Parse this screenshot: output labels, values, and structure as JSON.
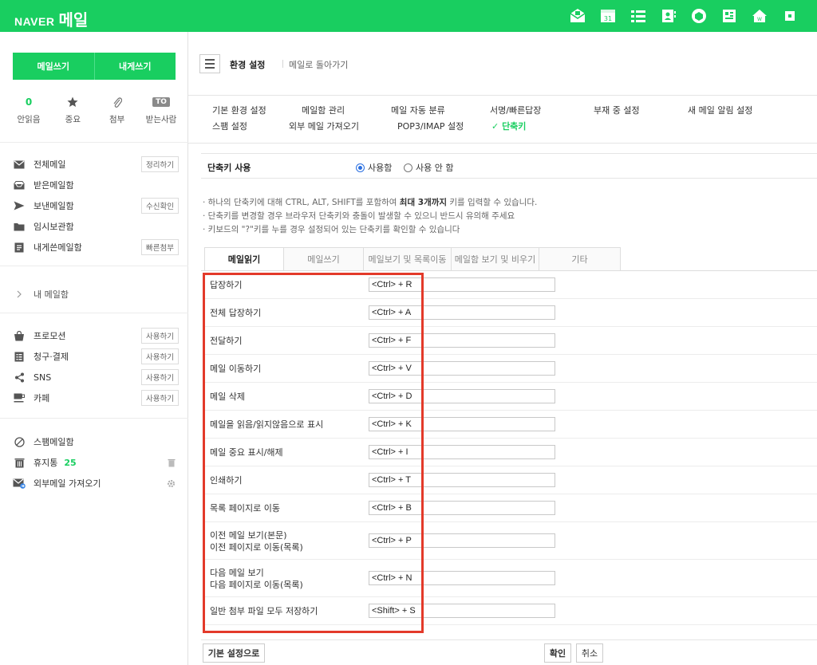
{
  "app": {
    "logo_brand": "NAVER",
    "logo_service": "메일",
    "colors": {
      "brand_green": "#19ce60",
      "highlight_red": "#e33a2a",
      "radio_blue": "#2a6fe0"
    },
    "top_icons": [
      "mail-app-icon",
      "calendar-icon",
      "list-icon",
      "contacts-icon",
      "cube-icon",
      "memo-icon",
      "home-icon",
      "square-icon"
    ],
    "calendar_number": "31"
  },
  "sidebar": {
    "compose_label": "메일쓰기",
    "self_compose_label": "내게쓰기",
    "quick": {
      "unread_count": "0",
      "unread_label": "안읽음",
      "important_label": "중요",
      "attach_label": "첨부",
      "to_badge": "TO",
      "to_label": "받는사람"
    },
    "folders": [
      {
        "label": "전체메일",
        "button": "정리하기"
      },
      {
        "label": "받은메일함",
        "button": ""
      },
      {
        "label": "보낸메일함",
        "button": "수신확인"
      },
      {
        "label": "임시보관함",
        "button": ""
      },
      {
        "label": "내게쓴메일함",
        "button": "빠른첨부"
      }
    ],
    "my_mailbox": "내 메일함",
    "category_folders": [
      {
        "label": "프로모션",
        "button": "사용하기"
      },
      {
        "label": "청구·결제",
        "button": "사용하기"
      },
      {
        "label": "SNS",
        "button": "사용하기"
      },
      {
        "label": "카페",
        "button": "사용하기"
      }
    ],
    "spam_label": "스팸메일함",
    "trash_label": "휴지통",
    "trash_count": "25",
    "external_label": "외부메일 가져오기"
  },
  "main": {
    "breadcrumb_title": "환경 설정",
    "breadcrumb_back": "메일로 돌아가기",
    "settings_nav": {
      "basic": "기본 환경 설정",
      "mailbox": "메일함 관리",
      "auto_sort": "메일 자동 분류",
      "signature": "서명/빠른답장",
      "away": "부재 중 설정",
      "new_mail_alert": "새 메일 알림 설정",
      "spam": "스팸 설정",
      "external": "외부 메일 가져오기",
      "pop3": "POP3/IMAP 설정",
      "shortcut": "단축키",
      "check_mark": "✓"
    },
    "shortcut_use": {
      "title": "단축키 사용",
      "on_label": "사용함",
      "off_label": "사용 안 함"
    },
    "notes": {
      "line1_prefix": "· 하나의 단축키에 대해 CTRL, ALT, SHIFT를 포함하여 ",
      "line1_bold": "최대 3개까지",
      "line1_suffix": " 키를 입력할 수 있습니다.",
      "line2": "· 단축키를 변경할 경우 브라우저 단축키와 충돌이 발생할 수 있으니 반드시 유의해 주세요",
      "line3": "· 키보드의 \"?\"키를 누를 경우 설정되어 있는 단축키를 확인할 수 있습니다"
    },
    "tabs": [
      "메일읽기",
      "메일쓰기",
      "메일보기 및 목록이동",
      "메일함 보기 및 비우기",
      "기타"
    ],
    "shortcuts": [
      {
        "label1": "답장하기",
        "label2": "",
        "key": "<Ctrl> + R"
      },
      {
        "label1": "전체 답장하기",
        "label2": "",
        "key": "<Ctrl> + A"
      },
      {
        "label1": "전달하기",
        "label2": "",
        "key": "<Ctrl> + F"
      },
      {
        "label1": "메일 이동하기",
        "label2": "",
        "key": "<Ctrl> + V"
      },
      {
        "label1": "메일 삭제",
        "label2": "",
        "key": "<Ctrl> + D"
      },
      {
        "label1": "메일을 읽음/읽지않음으로 표시",
        "label2": "",
        "key": "<Ctrl> + K"
      },
      {
        "label1": "메일 중요 표시/해제",
        "label2": "",
        "key": "<Ctrl> + I"
      },
      {
        "label1": "인쇄하기",
        "label2": "",
        "key": "<Ctrl> + T"
      },
      {
        "label1": "목록 페이지로 이동",
        "label2": "",
        "key": "<Ctrl> + B"
      },
      {
        "label1": "이전 메일 보기(본문)",
        "label2": "이전 페이지로 이동(목록)",
        "key": "<Ctrl> + P"
      },
      {
        "label1": "다음 메일 보기",
        "label2": "다음 페이지로 이동(목록)",
        "key": "<Ctrl> + N"
      },
      {
        "label1": "일반 첨부 파일 모두 저장하기",
        "label2": "",
        "key": "<Shift> + S"
      }
    ],
    "buttons": {
      "reset": "기본 설정으로",
      "confirm": "확인",
      "cancel": "취소"
    }
  }
}
